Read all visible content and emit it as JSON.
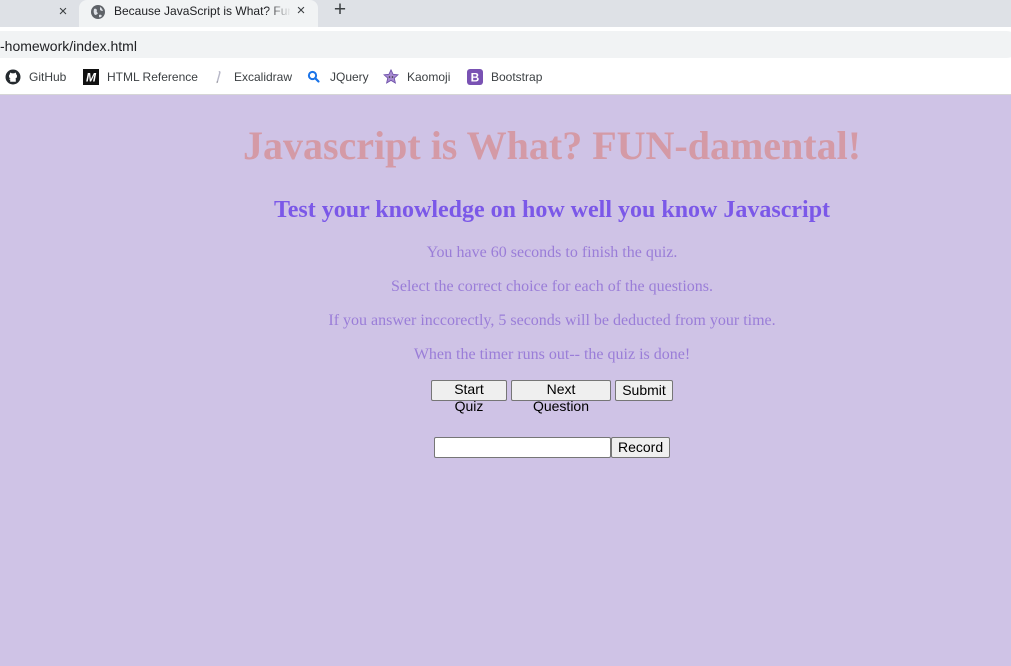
{
  "browser": {
    "tab_title": "Because JavaScript is What? Func",
    "tab_close": "×",
    "new_tab": "+",
    "url": "-homework/index.html"
  },
  "bookmarks": [
    {
      "label": "GitHub",
      "icon": "github-icon"
    },
    {
      "label": "HTML Reference",
      "icon": "html-reference-icon"
    },
    {
      "label": "Excalidraw",
      "icon": "excalidraw-icon"
    },
    {
      "label": "JQuery",
      "icon": "search-icon"
    },
    {
      "label": "Kaomoji",
      "icon": "kaomoji-icon"
    },
    {
      "label": "Bootstrap",
      "icon": "bootstrap-icon"
    }
  ],
  "page": {
    "title": "Javascript is What? FUN-damental!",
    "subtitle": "Test your knowledge on how well you know Javascript",
    "instructions": [
      "You have 60 seconds to finish the quiz.",
      "Select the correct choice for each of the questions.",
      "If you answer inccorectly, 5 seconds will be deducted from your time.",
      "When the timer runs out-- the quiz is done!"
    ],
    "buttons": {
      "start": "Start Quiz",
      "next": "Next Question",
      "submit": "Submit",
      "record": "Record"
    },
    "record_input_value": ""
  },
  "colors": {
    "page_background": "#cfc3e6",
    "title": "#d49aa6",
    "subtitle": "#7b58e8",
    "instructions": "#9a7dd8"
  }
}
